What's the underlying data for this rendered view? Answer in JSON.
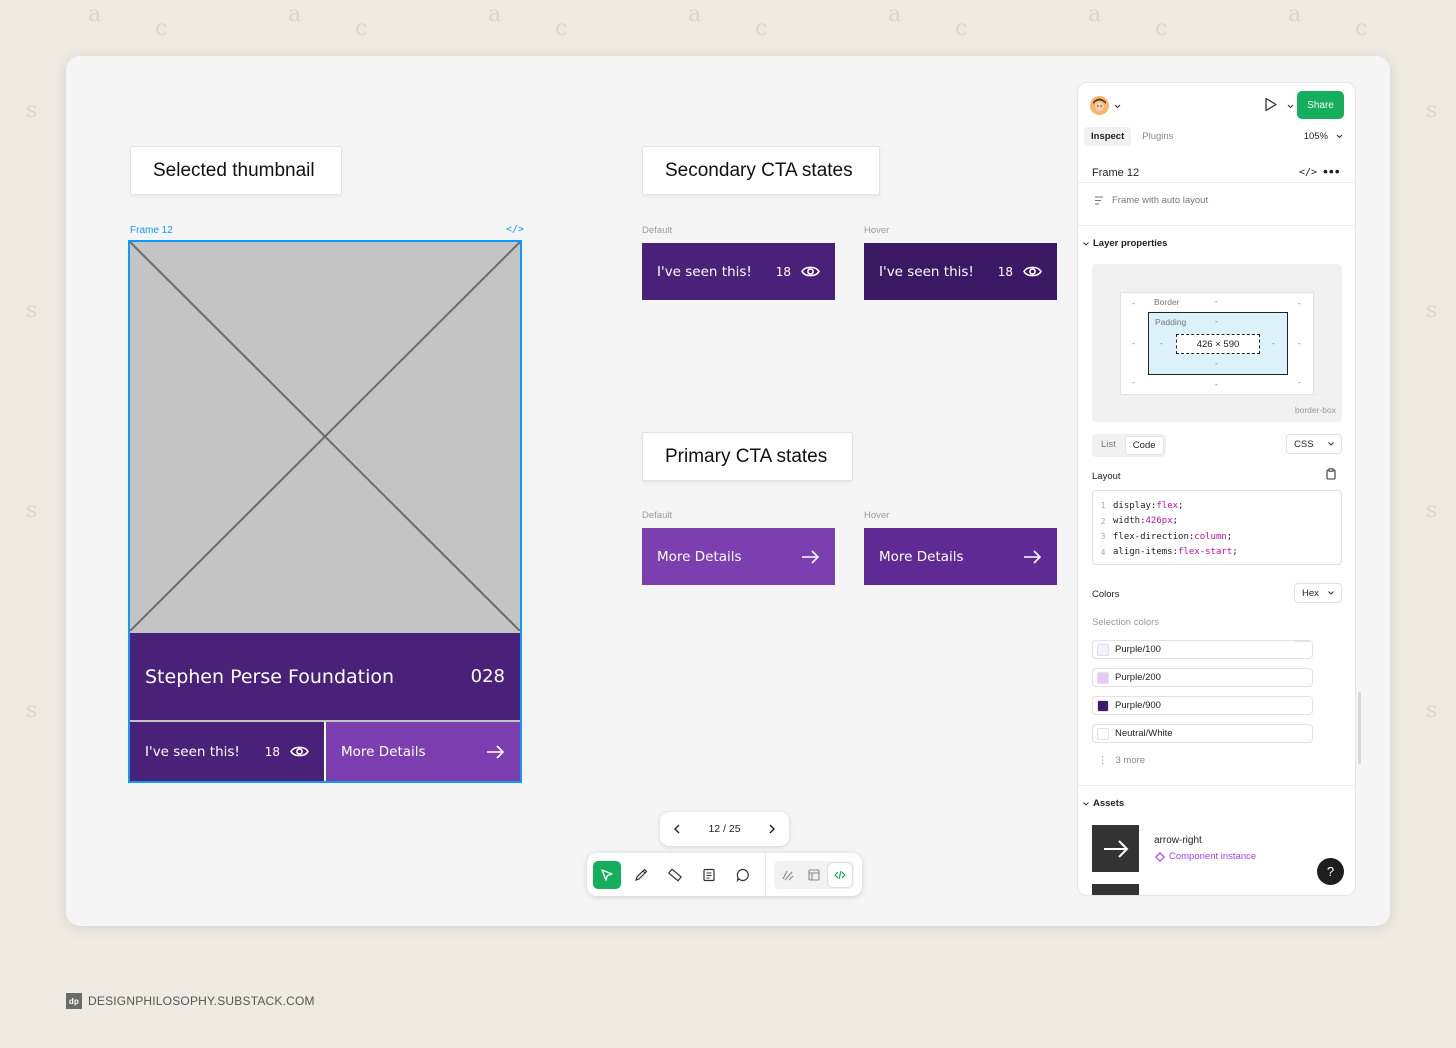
{
  "canvas": {
    "labels": {
      "selected_thumbnail": "Selected thumbnail",
      "secondary_cta": "Secondary CTA states",
      "primary_cta": "Primary CTA states"
    },
    "frame_label": "Frame 12",
    "code_icon": "</>",
    "state_default": "Default",
    "state_hover": "Hover",
    "secondary_buttons": [
      {
        "label": "I've seen this!",
        "count": "18"
      },
      {
        "label": "I've seen this!",
        "count": "18"
      }
    ],
    "primary_buttons": [
      {
        "label": "More Details"
      },
      {
        "label": "More Details"
      }
    ],
    "thumbnail": {
      "title": "Stephen Perse Foundation",
      "number": "028",
      "seen_label": "I've seen this!",
      "seen_count": "18",
      "details_label": "More Details"
    }
  },
  "pager": {
    "text": "12 / 25"
  },
  "panel": {
    "share_label": "Share",
    "tabs": [
      "Inspect",
      "Plugins"
    ],
    "zoom": "105%",
    "frame_name": "Frame 12",
    "frame_type": "Frame with auto layout",
    "layer_properties": "Layer properties",
    "box_model": {
      "border_label": "Border",
      "padding_label": "Padding",
      "dimensions": "426 × 590",
      "dash": "-",
      "sizing": "border-box"
    },
    "view_toggle": [
      "List",
      "Code"
    ],
    "language": "CSS",
    "layout_label": "Layout",
    "code_lines": [
      {
        "n": "1",
        "prop": "display: ",
        "val": "flex",
        "end": ";"
      },
      {
        "n": "2",
        "prop": "width: ",
        "val": "426px",
        "end": ";"
      },
      {
        "n": "3",
        "prop": "flex-direction: ",
        "val": "column",
        "end": ";"
      },
      {
        "n": "4",
        "prop": "align-items: ",
        "val": "flex-start",
        "end": ";"
      }
    ],
    "colors_label": "Colors",
    "color_format": "Hex",
    "selection_colors_label": "Selection colors",
    "colors": [
      {
        "name": "Purple/100",
        "hex": "#f5f0fb"
      },
      {
        "name": "Purple/200",
        "hex": "#e6c9f7"
      },
      {
        "name": "Purple/900",
        "hex": "#3f1c6e"
      },
      {
        "name": "Neutral/White",
        "hex": "#ffffff"
      }
    ],
    "more_colors": "3 more",
    "assets_label": "Assets",
    "asset": {
      "name": "arrow-right",
      "type": "Component instance"
    },
    "help": "?"
  },
  "footer": {
    "logo": "dp",
    "text": "DESIGNPHILOSOPHY.SUBSTACK.COM"
  }
}
